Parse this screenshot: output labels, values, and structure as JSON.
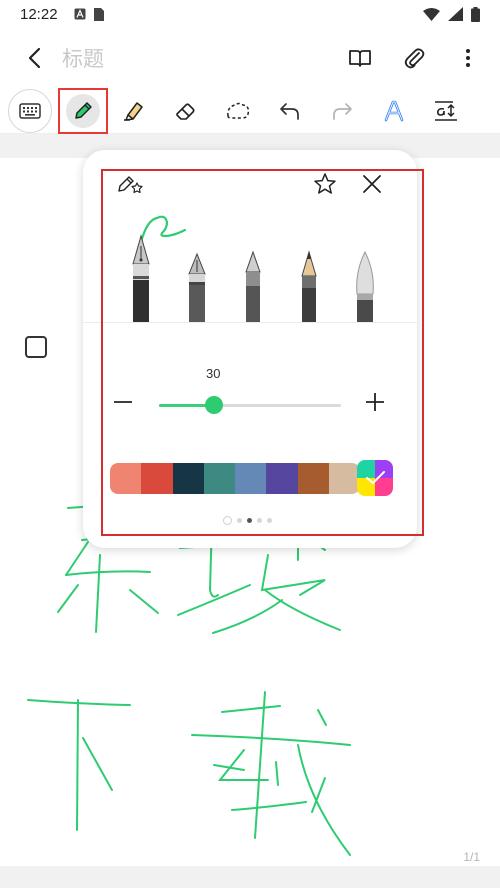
{
  "status_bar": {
    "time": "12:22"
  },
  "app_bar": {
    "title_placeholder": "标题"
  },
  "pen_panel": {
    "size_value": "30",
    "size_fraction": 0.3,
    "palette": [
      "#ef8470",
      "#d94a3d",
      "#163646",
      "#3e8a82",
      "#6489b7",
      "#5746a0",
      "#a75c30",
      "#d7bba1"
    ],
    "selected_color": "#2ecc71"
  },
  "footer": {
    "page_count": "1/1"
  },
  "colors": {
    "accent": "#2ecc71",
    "highlight_frame": "#d32f2f"
  },
  "icons": {
    "back": "back-arrow-icon",
    "book": "book-icon",
    "attach": "paperclip-icon",
    "more": "more-vertical-icon"
  }
}
